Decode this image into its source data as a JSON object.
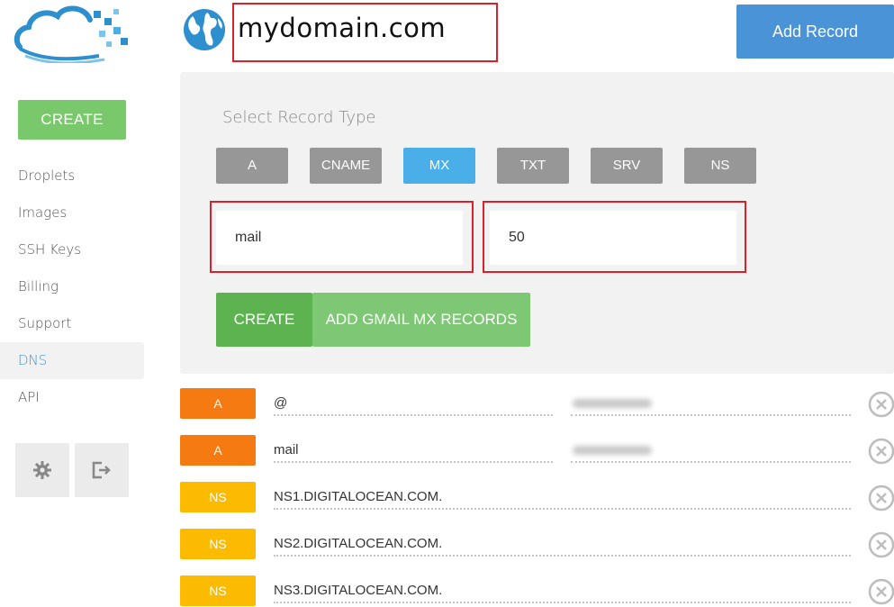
{
  "sidebar": {
    "create_label": "CREATE",
    "items": [
      {
        "label": "Droplets"
      },
      {
        "label": "Images"
      },
      {
        "label": "SSH Keys"
      },
      {
        "label": "Billing"
      },
      {
        "label": "Support"
      },
      {
        "label": "DNS",
        "active": true
      },
      {
        "label": "API"
      }
    ],
    "icons": [
      "gear-icon",
      "logout-icon"
    ]
  },
  "header": {
    "domain": "mydomain.com",
    "add_record_label": "Add Record"
  },
  "form": {
    "title": "Select Record Type",
    "record_types": [
      "A",
      "CNAME",
      "MX",
      "TXT",
      "SRV",
      "NS"
    ],
    "selected_type": "MX",
    "hostname_value": "mail",
    "priority_value": "50",
    "create_label": "CREATE",
    "gmail_label": "ADD GMAIL MX RECORDS"
  },
  "records": [
    {
      "type": "A",
      "name": "@"
    },
    {
      "type": "A",
      "name": "mail"
    },
    {
      "type": "NS",
      "name": "NS1.DIGITALOCEAN.COM."
    },
    {
      "type": "NS",
      "name": "NS2.DIGITALOCEAN.COM."
    },
    {
      "type": "NS",
      "name": "NS3.DIGITALOCEAN.COM."
    }
  ],
  "colors": {
    "a_badge": "#f57a12",
    "ns_badge": "#fdbb00",
    "accent_blue": "#4a93d6",
    "green": "#5cb34f",
    "highlight_red": "#d9212a"
  }
}
